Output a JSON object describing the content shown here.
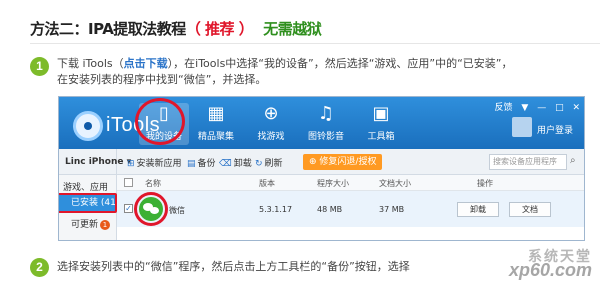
{
  "heading": {
    "main": "方法二：IPA提取法教程",
    "recommend": "（ 推荐 ）",
    "no_jailbreak": "无需越狱"
  },
  "step1": {
    "number": "1",
    "line1_a": "下载 iTools（",
    "line1_link": "点击下载",
    "line1_b": "），在iTools中选择“我的设备”，然后选择“游戏、应用”中的“已安装”，",
    "line2": "在安装列表的程序中找到“微信”，并选择。"
  },
  "itools": {
    "logo_text": "iTools",
    "nav": [
      {
        "label": "我的设备",
        "icon": "phone-icon"
      },
      {
        "label": "精品聚集",
        "icon": "grid-icon"
      },
      {
        "label": "找游戏",
        "icon": "gamepad-icon"
      },
      {
        "label": "图铃影音",
        "icon": "music-icon"
      },
      {
        "label": "工具箱",
        "icon": "toolbox-icon"
      }
    ],
    "top_links": [
      "反馈",
      "▼",
      "—",
      "□",
      "✕"
    ],
    "user_login": "用户登录",
    "device_name": "Linc iPhone",
    "toolbar": {
      "install": "安装新应用",
      "backup": "备份",
      "uninstall": "卸载",
      "refresh": "刷新",
      "fix_crash": "修复闪退/授权",
      "search_placeholder": "搜索设备应用程序"
    },
    "sidebar": {
      "category": "游戏、应用",
      "installed": "已安装 (41)",
      "updatable": "可更新",
      "update_count": "1"
    },
    "columns": [
      "名称",
      "版本",
      "程序大小",
      "文档大小",
      "操作"
    ],
    "row": {
      "name": "微信",
      "version": "5.3.1.17",
      "app_size": "48 MB",
      "doc_size": "37 MB",
      "uninstall": "卸载",
      "docs": "文档"
    }
  },
  "step2": {
    "number": "2",
    "text": "选择安装列表中的“微信”程序，然后点击上方工具栏的“备份”按钮，选择"
  },
  "watermark": {
    "top": "系统天堂",
    "bottom": "xp60.com"
  }
}
